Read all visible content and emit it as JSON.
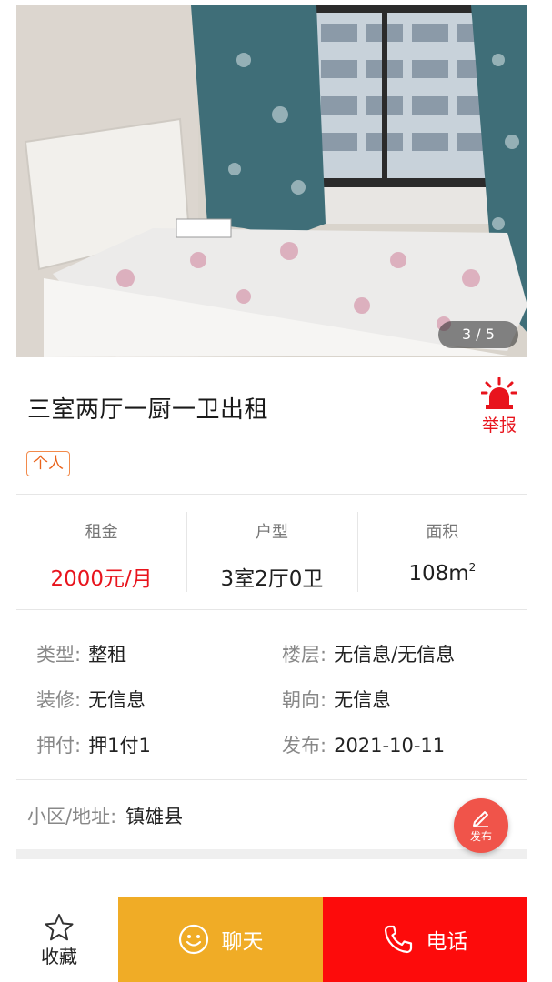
{
  "gallery": {
    "image_alt": "bedroom photo",
    "page_indicator": "3 / 5"
  },
  "listing": {
    "title": "三室两厅一厨一卫出租",
    "report_label": "举报",
    "tag": "个人"
  },
  "stats": [
    {
      "label": "租金",
      "value": "2000元/月"
    },
    {
      "label": "户型",
      "value": "3室2厅0卫"
    },
    {
      "label": "面积",
      "value": "108m",
      "unit_sup": "2"
    }
  ],
  "details": [
    {
      "key": "类型:",
      "value": "整租"
    },
    {
      "key": "楼层:",
      "value": "无信息/无信息"
    },
    {
      "key": "装修:",
      "value": "无信息"
    },
    {
      "key": "朝向:",
      "value": "无信息"
    },
    {
      "key": "押付:",
      "value": "押1付1"
    },
    {
      "key": "发布:",
      "value": "2021-10-11"
    }
  ],
  "address": {
    "key": "小区/地址:",
    "value": "镇雄县"
  },
  "fab": {
    "label": "发布",
    "icon": "pencil-icon"
  },
  "bottom_bar": {
    "favorite_label": "收藏",
    "chat_label": "聊天",
    "call_label": "电话"
  },
  "colors": {
    "accent_red": "#e8141d",
    "chat_orange": "#f0ac26",
    "call_red": "#fd0b0b",
    "tag_orange": "#e9621a"
  }
}
